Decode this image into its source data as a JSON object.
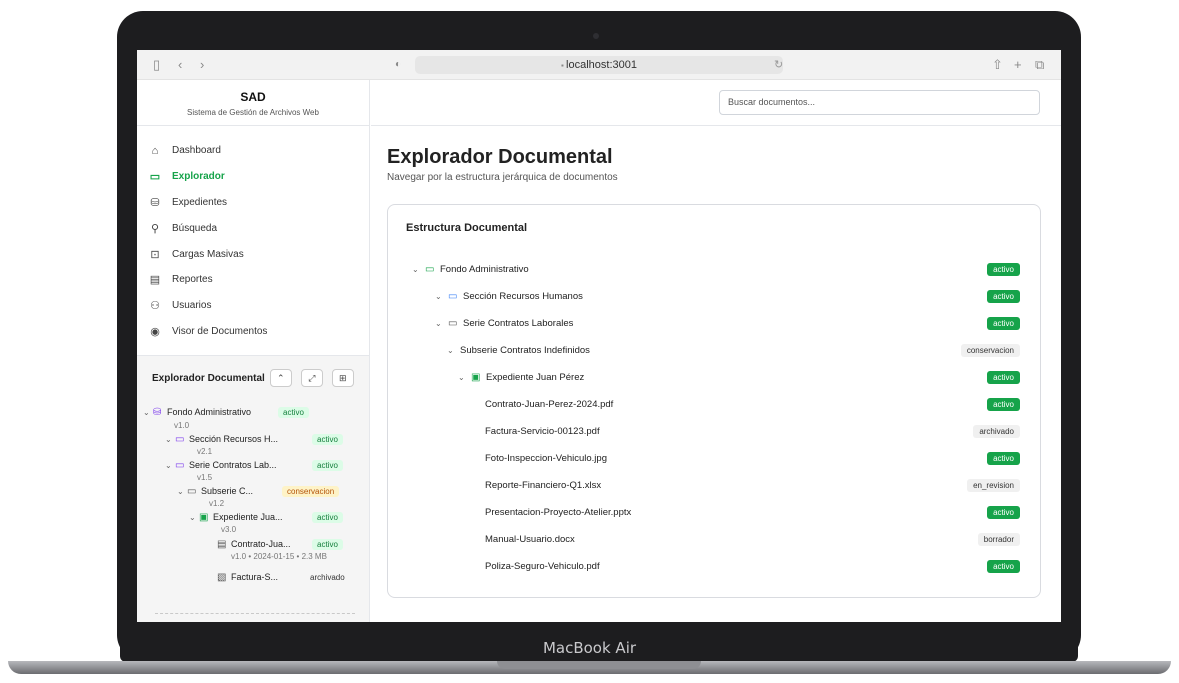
{
  "device": {
    "label": "MacBook Air"
  },
  "browser": {
    "url": "localhost:3001",
    "url_icon": "lock-icon"
  },
  "sidebar": {
    "app_name": "SAD",
    "app_subtitle": "Sistema de Gestión de Archivos Web",
    "items": [
      {
        "label": "Dashboard",
        "icon": "home-icon",
        "active": false
      },
      {
        "label": "Explorador",
        "icon": "folder-icon",
        "active": true
      },
      {
        "label": "Expedientes",
        "icon": "database-icon",
        "active": false
      },
      {
        "label": "Búsqueda",
        "icon": "search-icon",
        "active": false
      },
      {
        "label": "Cargas Masivas",
        "icon": "upload-icon",
        "active": false
      },
      {
        "label": "Reportes",
        "icon": "report-icon",
        "active": false
      },
      {
        "label": "Usuarios",
        "icon": "users-icon",
        "active": false
      },
      {
        "label": "Visor de Documentos",
        "icon": "eye-icon",
        "active": false
      }
    ],
    "tree_panel": {
      "title": "Explorador Documental",
      "nodes": [
        {
          "name": "Fondo Administrativo",
          "version": "v1.0",
          "status": "activo"
        },
        {
          "name": "Sección Recursos H...",
          "version": "v2.1",
          "status": "activo"
        },
        {
          "name": "Serie Contratos Lab...",
          "version": "v1.5",
          "status": "activo"
        },
        {
          "name": "Subserie C...",
          "version": "v1.2",
          "status": "conservacion"
        },
        {
          "name": "Expediente Jua...",
          "version": "v3.0",
          "status": "activo"
        },
        {
          "name": "Contrato-Jua...",
          "version": "v1.0",
          "date": "• 2024-01-15",
          "size": "• 2.3 MB",
          "status": "activo"
        },
        {
          "name": "Factura-S...",
          "version": "",
          "status": "archivado"
        }
      ]
    }
  },
  "header": {
    "search_placeholder": "Buscar documentos..."
  },
  "main": {
    "title": "Explorador Documental",
    "subtitle": "Navegar por la estructura jerárquica de documentos",
    "card_title": "Estructura Documental",
    "rows": [
      {
        "label": "Fondo Administrativo",
        "status": "activo"
      },
      {
        "label": "Sección Recursos Humanos",
        "status": "activo"
      },
      {
        "label": "Serie Contratos Laborales",
        "status": "activo"
      },
      {
        "label": "Subserie Contratos Indefinidos",
        "status": "conservacion"
      },
      {
        "label": "Expediente Juan Pérez",
        "status": "activo"
      },
      {
        "label": "Contrato-Juan-Perez-2024.pdf",
        "status": "activo"
      },
      {
        "label": "Factura-Servicio-00123.pdf",
        "status": "archivado"
      },
      {
        "label": "Foto-Inspeccion-Vehiculo.jpg",
        "status": "activo"
      },
      {
        "label": "Reporte-Financiero-Q1.xlsx",
        "status": "en_revision"
      },
      {
        "label": "Presentacion-Proyecto-Atelier.pptx",
        "status": "activo"
      },
      {
        "label": "Manual-Usuario.docx",
        "status": "borrador"
      },
      {
        "label": "Poliza-Seguro-Vehiculo.pdf",
        "status": "activo"
      }
    ]
  },
  "colors": {
    "accent": "#16a34a",
    "badge_active": "#16a34a",
    "badge_neutral": "#f0f0f0"
  }
}
